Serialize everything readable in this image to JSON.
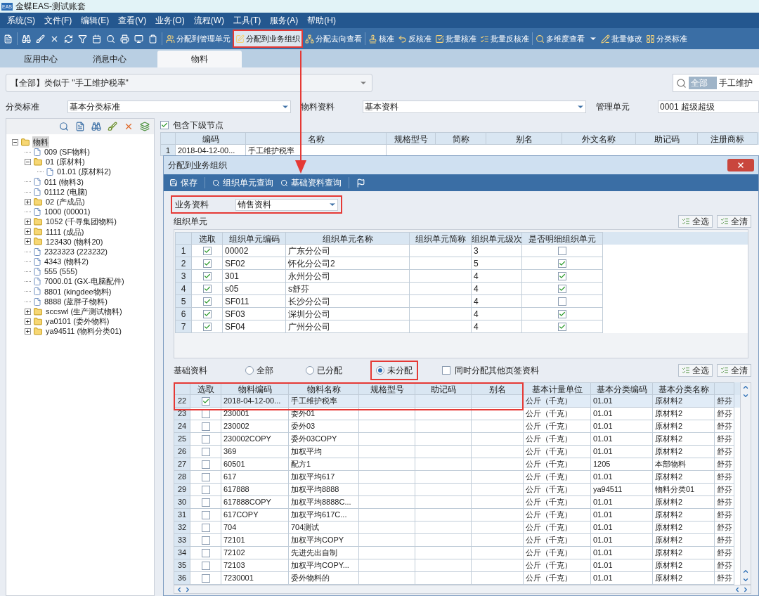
{
  "window": {
    "icon_text": "EAS",
    "title": "金蝶EAS-测试账套"
  },
  "menu": [
    "系统(S)",
    "文件(F)",
    "编辑(E)",
    "查看(V)",
    "业务(O)",
    "流程(W)",
    "工具(T)",
    "服务(A)",
    "帮助(H)"
  ],
  "toolbar": [
    {
      "label": "分配到管理单元",
      "kind": "button",
      "annotated": false
    },
    {
      "label": "分配到业务组织",
      "kind": "button",
      "annotated": true
    },
    {
      "label": "分配去向查看",
      "kind": "button",
      "annotated": false
    },
    {
      "label": "核准",
      "kind": "button",
      "annotated": false
    },
    {
      "label": "反核准",
      "kind": "button",
      "annotated": false
    },
    {
      "label": "批量核准",
      "kind": "button",
      "annotated": false
    },
    {
      "label": "批量反核准",
      "kind": "button",
      "annotated": false
    },
    {
      "label": "多维度查看",
      "kind": "dropdown",
      "annotated": false
    },
    {
      "label": "批量修改",
      "kind": "button",
      "annotated": false
    },
    {
      "label": "分类标准",
      "kind": "button",
      "annotated": false
    }
  ],
  "tabs": [
    {
      "label": "应用中心",
      "selected": false
    },
    {
      "label": "消息中心",
      "selected": false
    },
    {
      "label": "物料",
      "selected": true
    }
  ],
  "query": {
    "value": "【全部】类似于 \"手工维护税率\""
  },
  "search": {
    "scope": "全部",
    "value": "手工维护"
  },
  "filters": [
    {
      "label": "分类标准",
      "value": "基本分类标准"
    },
    {
      "label": "物料资料",
      "value": "基本资料"
    },
    {
      "label": "管理单元",
      "value": "0001 超级超级"
    }
  ],
  "tree": [
    {
      "label": "物料",
      "kind": "folder",
      "expanded": true,
      "selected": true,
      "children": [
        {
          "label": "009 (SF物料)",
          "kind": "leaf",
          "selected": false
        },
        {
          "label": "01 (原材料)",
          "kind": "folder",
          "expanded": true,
          "selected": false,
          "children": [
            {
              "label": "01.01 (原材料2)",
              "kind": "leaf",
              "selected": false
            }
          ]
        },
        {
          "label": "011 (物料3)",
          "kind": "leaf",
          "selected": false
        },
        {
          "label": "01112 (电脑)",
          "kind": "leaf",
          "selected": false
        },
        {
          "label": "02 (产成品)",
          "kind": "folder",
          "expanded": false,
          "selected": false
        },
        {
          "label": "1000 (00001)",
          "kind": "leaf",
          "selected": false
        },
        {
          "label": "1052 (千寻集团物料)",
          "kind": "folder",
          "expanded": false,
          "selected": false
        },
        {
          "label": "1111 (成品)",
          "kind": "folder",
          "expanded": false,
          "selected": false
        },
        {
          "label": "123430 (物料20)",
          "kind": "folder",
          "expanded": false,
          "selected": false
        },
        {
          "label": "2323323 (223232)",
          "kind": "leaf",
          "selected": false
        },
        {
          "label": "4343 (物料2)",
          "kind": "leaf",
          "selected": false
        },
        {
          "label": "555 (555)",
          "kind": "leaf",
          "selected": false
        },
        {
          "label": "7000.01 (GX-电脑配件)",
          "kind": "leaf",
          "selected": false
        },
        {
          "label": "8801 (kingdee物料)",
          "kind": "leaf",
          "selected": false
        },
        {
          "label": "8888 (蓝胖子物料)",
          "kind": "leaf",
          "selected": false
        },
        {
          "label": "sccswl (生产测试物料)",
          "kind": "folder",
          "expanded": false,
          "selected": false
        },
        {
          "label": "ya0101 (委外物料)",
          "kind": "folder",
          "expanded": false,
          "selected": false
        },
        {
          "label": "ya94511 (物料分类01)",
          "kind": "folder",
          "expanded": false,
          "selected": false
        }
      ]
    }
  ],
  "include_children": {
    "label": "包含下级节点",
    "checked": true
  },
  "material_table": {
    "columns": [
      "编码",
      "名称",
      "规格型号",
      "简称",
      "别名",
      "外文名称",
      "助记码",
      "注册商标"
    ],
    "rows": [
      {
        "index": "1",
        "code": "2018-04-12-00...",
        "name": "手工维护税率"
      }
    ]
  },
  "annotation_arrow": true,
  "dialog": {
    "title": "分配到业务组织",
    "toolbar": [
      "保存",
      "组织单元查询",
      "基础资料查询"
    ],
    "business_data": {
      "label": "业务资料",
      "value": "销售资料",
      "annotated": true
    },
    "org_section": {
      "label": "组织单元",
      "buttons": [
        "全选",
        "全清"
      ]
    },
    "org_table": {
      "columns": [
        "选取",
        "组织单元编码",
        "组织单元名称",
        "组织单元简称",
        "组织单元级次",
        "是否明细组织单元"
      ],
      "rows": [
        {
          "index": "1",
          "picked": true,
          "code": "00002",
          "name": "广东分公司",
          "level": "3",
          "is_detail": false
        },
        {
          "index": "2",
          "picked": true,
          "code": "SF02",
          "name": "怀化分公司2",
          "level": "5",
          "is_detail": true
        },
        {
          "index": "3",
          "picked": true,
          "code": "301",
          "name": "永州分公司",
          "level": "4",
          "is_detail": true
        },
        {
          "index": "4",
          "picked": true,
          "code": "s05",
          "name": "s舒芬",
          "level": "4",
          "is_detail": true
        },
        {
          "index": "5",
          "picked": true,
          "code": "SF011",
          "name": "长沙分公司",
          "level": "4",
          "is_detail": false
        },
        {
          "index": "6",
          "picked": true,
          "code": "SF03",
          "name": "深圳分公司",
          "level": "4",
          "is_detail": true
        },
        {
          "index": "7",
          "picked": true,
          "code": "SF04",
          "name": "广州分公司",
          "level": "4",
          "is_detail": true
        }
      ]
    },
    "base_filter": {
      "label": "基础资料",
      "options": [
        {
          "label": "全部",
          "selected": false,
          "annotated": false
        },
        {
          "label": "已分配",
          "selected": false,
          "annotated": false
        },
        {
          "label": "未分配",
          "selected": true,
          "annotated": true
        }
      ],
      "also_assign": {
        "label": "同时分配其他页签资料",
        "checked": false
      },
      "buttons": [
        "全选",
        "全清"
      ]
    },
    "base_table": {
      "annotated_frame": true,
      "columns": [
        "选取",
        "物料编码",
        "物料名称",
        "规格型号",
        "助记码",
        "别名",
        "基本计量单位",
        "基本分类编码",
        "基本分类名称"
      ],
      "rows": [
        {
          "index": "22",
          "picked": true,
          "selected": true,
          "code": "2018-04-12-00...",
          "name": "手工维护税率",
          "unit": "公斤（千克）",
          "class_code": "01.01",
          "class_name": "原材料2",
          "column_11": "舒芬"
        },
        {
          "index": "23",
          "picked": false,
          "selected": false,
          "code": "230001",
          "name": "委外01",
          "unit": "公斤（千克）",
          "class_code": "01.01",
          "class_name": "原材料2",
          "column_11": "舒芬"
        },
        {
          "index": "24",
          "picked": false,
          "selected": false,
          "code": "230002",
          "name": "委外03",
          "unit": "公斤（千克）",
          "class_code": "01.01",
          "class_name": "原材料2",
          "column_11": "舒芬"
        },
        {
          "index": "25",
          "picked": false,
          "selected": false,
          "code": "230002COPY",
          "name": "委外03COPY",
          "unit": "公斤（千克）",
          "class_code": "01.01",
          "class_name": "原材料2",
          "column_11": "舒芬"
        },
        {
          "index": "26",
          "picked": false,
          "selected": false,
          "code": "369",
          "name": "加权平均",
          "unit": "公斤（千克）",
          "class_code": "01.01",
          "class_name": "原材料2",
          "column_11": "舒芬"
        },
        {
          "index": "27",
          "picked": false,
          "selected": false,
          "code": "60501",
          "name": "配方1",
          "unit": "公斤（千克）",
          "class_code": "1205",
          "class_name": "本部物料",
          "column_11": "舒芬"
        },
        {
          "index": "28",
          "picked": false,
          "selected": false,
          "code": "617",
          "name": "加权平均617",
          "unit": "公斤（千克）",
          "class_code": "01.01",
          "class_name": "原材料2",
          "column_11": "舒芬"
        },
        {
          "index": "29",
          "picked": false,
          "selected": false,
          "code": "617888",
          "name": "加权平均8888",
          "unit": "公斤（千克）",
          "class_code": "ya94511",
          "class_name": "物料分类01",
          "column_11": "舒芬"
        },
        {
          "index": "30",
          "picked": false,
          "selected": false,
          "code": "617888COPY",
          "name": "加权平均8888C...",
          "unit": "公斤（千克）",
          "class_code": "01.01",
          "class_name": "原材料2",
          "column_11": "舒芬"
        },
        {
          "index": "31",
          "picked": false,
          "selected": false,
          "code": "617COPY",
          "name": "加权平均617C...",
          "unit": "公斤（千克）",
          "class_code": "01.01",
          "class_name": "原材料2",
          "column_11": "舒芬"
        },
        {
          "index": "32",
          "picked": false,
          "selected": false,
          "code": "704",
          "name": "704测试",
          "unit": "公斤（千克）",
          "class_code": "01.01",
          "class_name": "原材料2",
          "column_11": "舒芬"
        },
        {
          "index": "33",
          "picked": false,
          "selected": false,
          "code": "72101",
          "name": "加权平均COPY",
          "unit": "公斤（千克）",
          "class_code": "01.01",
          "class_name": "原材料2",
          "column_11": "舒芬"
        },
        {
          "index": "34",
          "picked": false,
          "selected": false,
          "code": "72102",
          "name": "先进先出自制",
          "unit": "公斤（千克）",
          "class_code": "01.01",
          "class_name": "原材料2",
          "column_11": "舒芬"
        },
        {
          "index": "35",
          "picked": false,
          "selected": false,
          "code": "72103",
          "name": "加权平均COPY...",
          "unit": "公斤（千克）",
          "class_code": "01.01",
          "class_name": "原材料2",
          "column_11": "舒芬"
        },
        {
          "index": "36",
          "picked": false,
          "selected": false,
          "code": "7230001",
          "name": "委外物料的",
          "unit": "公斤（千克）",
          "class_code": "01.01",
          "class_name": "原材料2",
          "column_11": "舒芬"
        }
      ]
    }
  }
}
